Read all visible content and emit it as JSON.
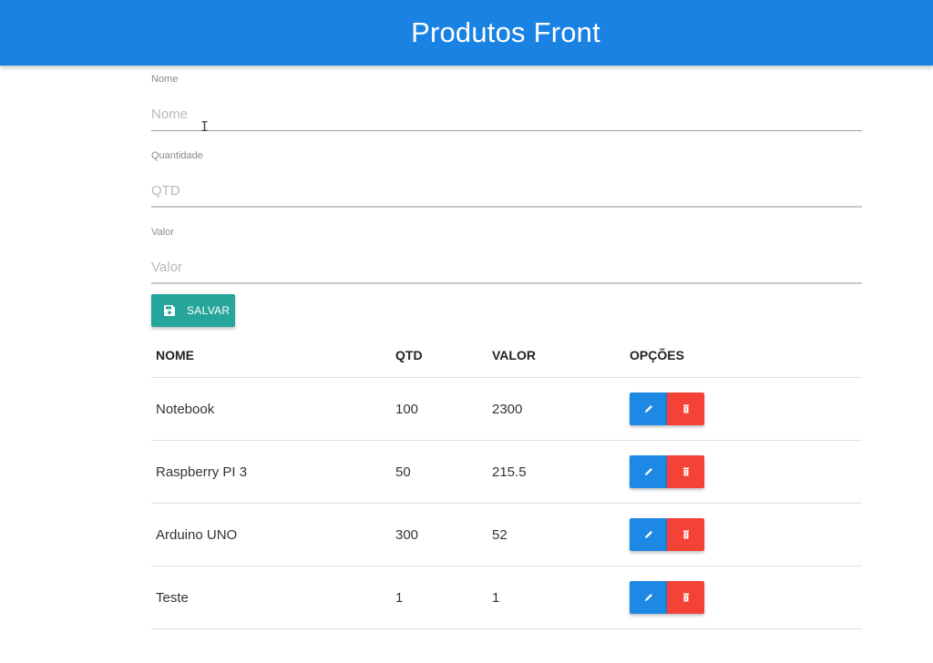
{
  "header": {
    "title": "Produtos Front"
  },
  "form": {
    "nome": {
      "label": "Nome",
      "placeholder": "Nome",
      "value": ""
    },
    "quantidade": {
      "label": "Quantidade",
      "placeholder": "QTD",
      "value": ""
    },
    "valor": {
      "label": "Valor",
      "placeholder": "Valor",
      "value": ""
    },
    "save_label": "SALVAR"
  },
  "table": {
    "headers": {
      "nome": "NOME",
      "qtd": "QTD",
      "valor": "VALOR",
      "opcoes": "OPÇÕES"
    },
    "rows": [
      {
        "nome": "Notebook",
        "qtd": "100",
        "valor": "2300"
      },
      {
        "nome": "Raspberry PI 3",
        "qtd": "50",
        "valor": "215.5"
      },
      {
        "nome": "Arduino UNO",
        "qtd": "300",
        "valor": "52"
      },
      {
        "nome": "Teste",
        "qtd": "1",
        "valor": "1"
      }
    ]
  },
  "icons": {
    "save": "floppy-disk-icon",
    "edit": "pencil-icon",
    "delete": "trash-icon"
  },
  "colors": {
    "navbar": "#1a82e2",
    "save_button": "#26a69a",
    "edit_button": "#1e88e5",
    "delete_button": "#f44336"
  }
}
